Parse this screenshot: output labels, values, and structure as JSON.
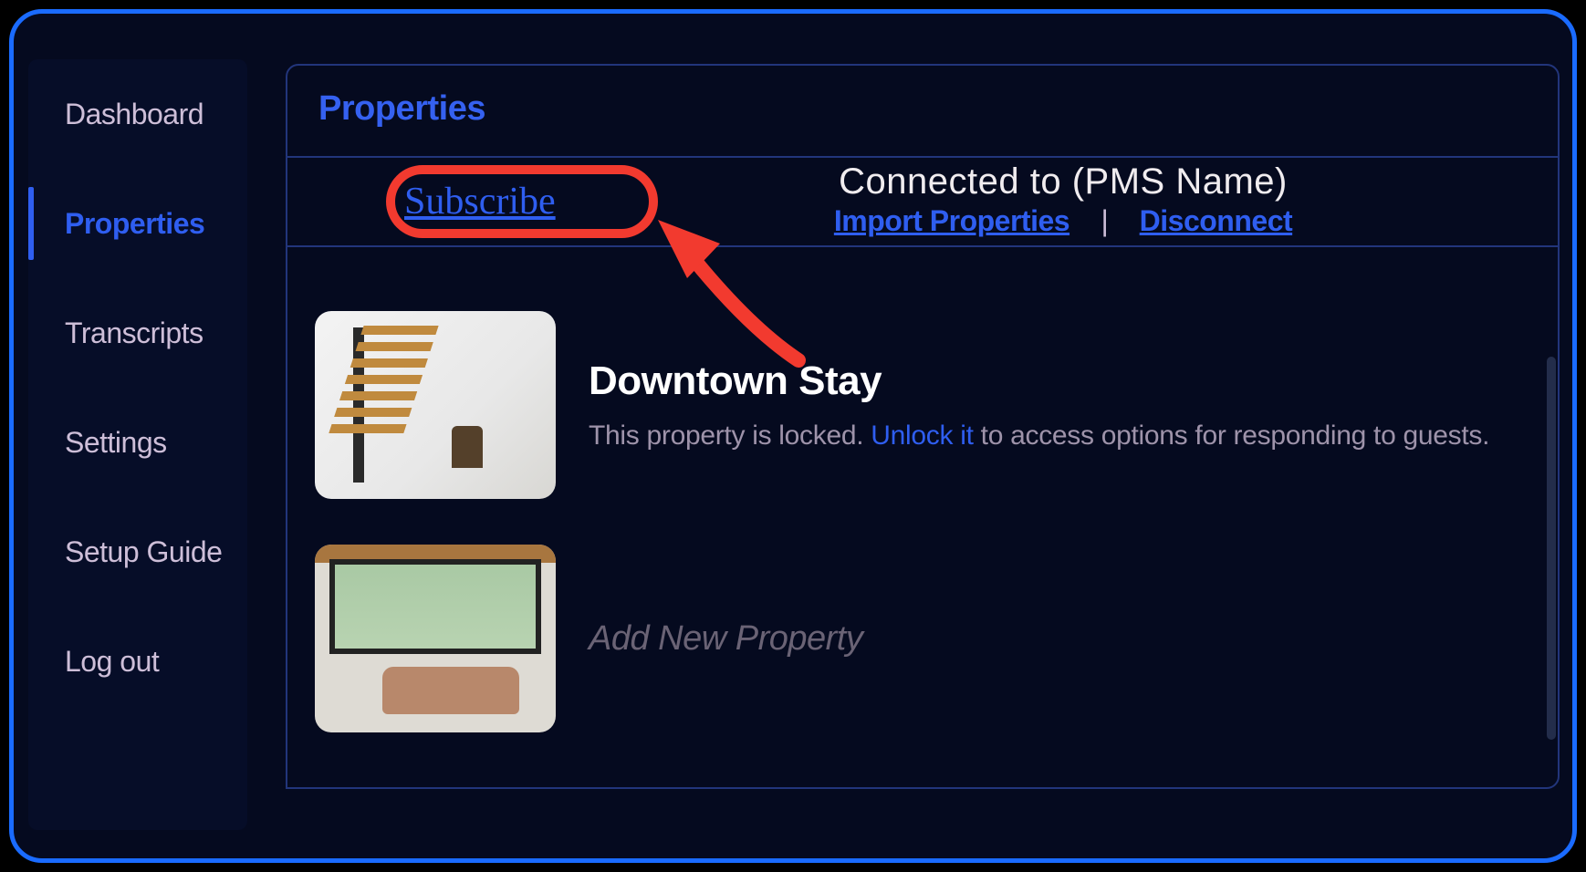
{
  "sidebar": {
    "items": [
      {
        "label": "Dashboard",
        "active": false
      },
      {
        "label": "Properties",
        "active": true
      },
      {
        "label": "Transcripts",
        "active": false
      },
      {
        "label": "Settings",
        "active": false
      },
      {
        "label": "Setup Guide",
        "active": false
      },
      {
        "label": "Log out",
        "active": false
      }
    ]
  },
  "main": {
    "title": "Properties",
    "subscribe_label": "Subscribe",
    "pms": {
      "connected_text": "Connected to (PMS Name)",
      "import_label": "Import Properties",
      "separator": "|",
      "disconnect_label": "Disconnect"
    },
    "properties": [
      {
        "name": "Downtown Stay",
        "locked_text_prefix": "This property is locked. ",
        "unlock_label": "Unlock it",
        "locked_text_suffix": " to access options for responding to guests."
      }
    ],
    "add_new_label": "Add New Property"
  },
  "annotation": {
    "highlight_target": "subscribe-link",
    "arrow_points_to": "subscribe-link"
  }
}
